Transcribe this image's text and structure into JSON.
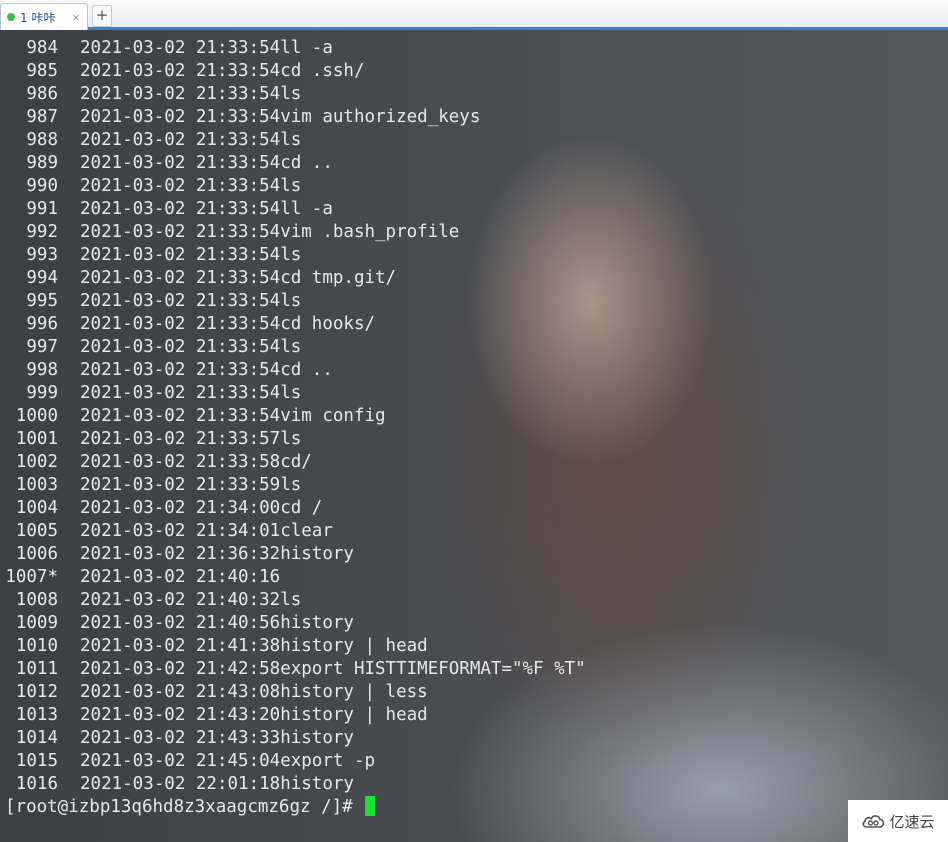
{
  "tab": {
    "label": "1 咔咔",
    "close_glyph": "×",
    "add_glyph": "+"
  },
  "history": [
    {
      "num": "984",
      "time": "2021-03-02 21:33:54",
      "cmd": "ll -a"
    },
    {
      "num": "985",
      "time": "2021-03-02 21:33:54",
      "cmd": "cd .ssh/"
    },
    {
      "num": "986",
      "time": "2021-03-02 21:33:54",
      "cmd": "ls"
    },
    {
      "num": "987",
      "time": "2021-03-02 21:33:54",
      "cmd": "vim authorized_keys"
    },
    {
      "num": "988",
      "time": "2021-03-02 21:33:54",
      "cmd": "ls"
    },
    {
      "num": "989",
      "time": "2021-03-02 21:33:54",
      "cmd": "cd .."
    },
    {
      "num": "990",
      "time": "2021-03-02 21:33:54",
      "cmd": "ls"
    },
    {
      "num": "991",
      "time": "2021-03-02 21:33:54",
      "cmd": "ll -a"
    },
    {
      "num": "992",
      "time": "2021-03-02 21:33:54",
      "cmd": "vim .bash_profile"
    },
    {
      "num": "993",
      "time": "2021-03-02 21:33:54",
      "cmd": "ls"
    },
    {
      "num": "994",
      "time": "2021-03-02 21:33:54",
      "cmd": "cd tmp.git/"
    },
    {
      "num": "995",
      "time": "2021-03-02 21:33:54",
      "cmd": "ls"
    },
    {
      "num": "996",
      "time": "2021-03-02 21:33:54",
      "cmd": "cd hooks/"
    },
    {
      "num": "997",
      "time": "2021-03-02 21:33:54",
      "cmd": "ls"
    },
    {
      "num": "998",
      "time": "2021-03-02 21:33:54",
      "cmd": "cd .."
    },
    {
      "num": "999",
      "time": "2021-03-02 21:33:54",
      "cmd": "ls"
    },
    {
      "num": "1000",
      "time": "2021-03-02 21:33:54",
      "cmd": "vim config"
    },
    {
      "num": "1001",
      "time": "2021-03-02 21:33:57",
      "cmd": "ls"
    },
    {
      "num": "1002",
      "time": "2021-03-02 21:33:58",
      "cmd": "cd/"
    },
    {
      "num": "1003",
      "time": "2021-03-02 21:33:59",
      "cmd": "ls"
    },
    {
      "num": "1004",
      "time": "2021-03-02 21:34:00",
      "cmd": "cd /"
    },
    {
      "num": "1005",
      "time": "2021-03-02 21:34:01",
      "cmd": "clear"
    },
    {
      "num": "1006",
      "time": "2021-03-02 21:36:32",
      "cmd": "history"
    },
    {
      "num": "1007*",
      "time": "2021-03-02 21:40:16",
      "cmd": ""
    },
    {
      "num": "1008",
      "time": "2021-03-02 21:40:32",
      "cmd": "ls"
    },
    {
      "num": "1009",
      "time": "2021-03-02 21:40:56",
      "cmd": "history"
    },
    {
      "num": "1010",
      "time": "2021-03-02 21:41:38",
      "cmd": "history | head"
    },
    {
      "num": "1011",
      "time": "2021-03-02 21:42:58",
      "cmd": "export HISTTIMEFORMAT=\"%F %T\""
    },
    {
      "num": "1012",
      "time": "2021-03-02 21:43:08",
      "cmd": "history | less"
    },
    {
      "num": "1013",
      "time": "2021-03-02 21:43:20",
      "cmd": "history | head"
    },
    {
      "num": "1014",
      "time": "2021-03-02 21:43:33",
      "cmd": "history"
    },
    {
      "num": "1015",
      "time": "2021-03-02 21:45:04",
      "cmd": "export -p"
    },
    {
      "num": "1016",
      "time": "2021-03-02 22:01:18",
      "cmd": "history"
    }
  ],
  "prompt": "[root@izbp13q6hd8z3xaagcmz6gz /]# ",
  "watermark": {
    "icon": "cloud-logo-icon",
    "text": "亿速云"
  }
}
